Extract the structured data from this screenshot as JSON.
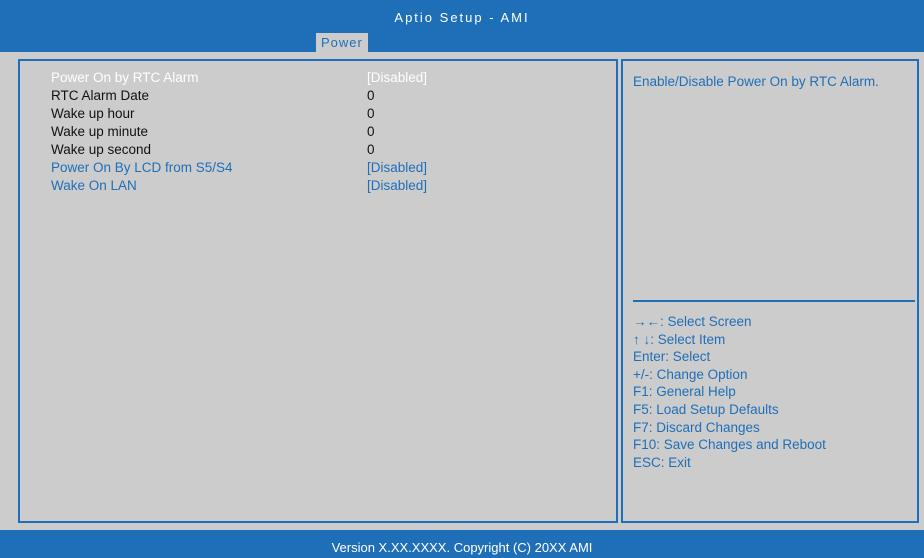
{
  "header": {
    "title": "Aptio Setup - AMI",
    "tab": "Power"
  },
  "settings": [
    {
      "label": "Power On by RTC Alarm",
      "value": "[Disabled]",
      "state": "selected"
    },
    {
      "label": "RTC Alarm Date",
      "value": "0",
      "state": "static"
    },
    {
      "label": "Wake up hour",
      "value": "0",
      "state": "static"
    },
    {
      "label": "Wake up minute",
      "value": "0",
      "state": "static"
    },
    {
      "label": "Wake up second",
      "value": "0",
      "state": "static"
    },
    {
      "label": "Power On By LCD from S5/S4",
      "value": "[Disabled]",
      "state": "option"
    },
    {
      "label": "Wake On LAN",
      "value": "[Disabled]",
      "state": "option"
    }
  ],
  "help": {
    "text": "Enable/Disable Power On by RTC Alarm."
  },
  "keys": [
    "→←: Select Screen",
    "↑ ↓: Select Item",
    "Enter: Select",
    "+/-: Change Option",
    "F1: General Help",
    "F5: Load Setup Defaults",
    "F7: Discard Changes",
    "F10: Save Changes and Reboot",
    "ESC: Exit"
  ],
  "footer": {
    "text": "Version X.XX.XXXX. Copyright (C) 20XX AMI"
  },
  "colors": {
    "accent": "#1f6fb8",
    "panel": "#cccccc",
    "selected_text": "#ffffff",
    "static_text": "#111111"
  }
}
